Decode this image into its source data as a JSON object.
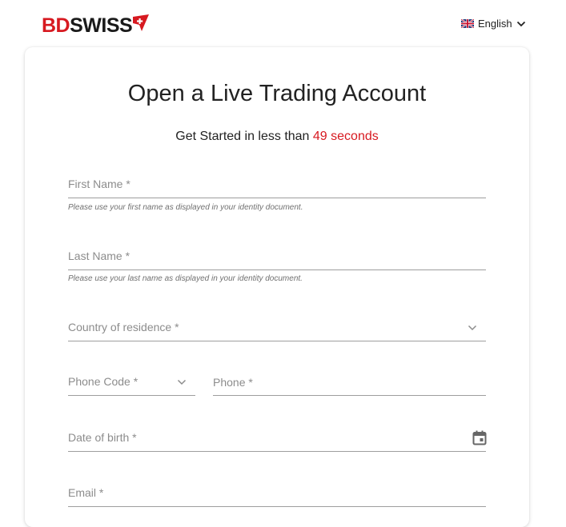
{
  "brand": {
    "logo_part1": "BD",
    "logo_part2": "SWISS",
    "color_red": "#d71920"
  },
  "language": {
    "selected": "English",
    "flag_icon": "uk-flag-icon",
    "dropdown_icon": "chevron-down-icon"
  },
  "form": {
    "title": "Open a Live Trading Account",
    "subtitle_prefix": "Get Started in less than ",
    "subtitle_highlight": "49 seconds",
    "first_name": {
      "label": "First Name *",
      "helper": "Please use your first name as displayed in your identity document."
    },
    "last_name": {
      "label": "Last Name *",
      "helper": "Please use your last name as displayed in your identity document."
    },
    "country": {
      "label": "Country of residence *"
    },
    "phone_code": {
      "label": "Phone Code *"
    },
    "phone": {
      "label": "Phone *"
    },
    "dob": {
      "label": "Date of birth *",
      "icon": "calendar-icon"
    },
    "email": {
      "label": "Email *"
    }
  }
}
